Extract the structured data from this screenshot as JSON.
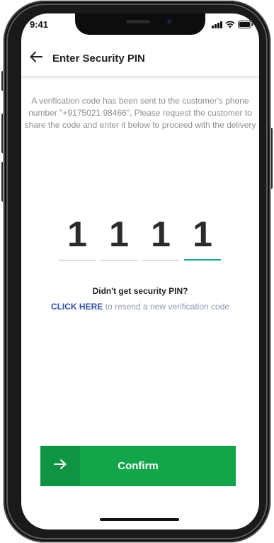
{
  "status_bar": {
    "time": "9:41"
  },
  "header": {
    "title": "Enter Security PIN",
    "back_icon": "arrow-left-icon"
  },
  "message": {
    "text": "A verification code has been sent to the customer's phone number \"+9175021 98466\", Please request the customer to share the code and enter it below to proceed with the delivery"
  },
  "pin": {
    "digits": [
      "1",
      "1",
      "1",
      "1"
    ],
    "active_index": 3
  },
  "resend": {
    "question": "Didn't get security PIN?",
    "link_label": "CLICK HERE",
    "suffix": " to resend a new verification code"
  },
  "confirm": {
    "label": "Confirm",
    "icon": "arrow-right-icon"
  },
  "colors": {
    "primary_green": "#12a54a",
    "dark_green": "#0f9443",
    "active_underline": "#1a9e8f",
    "link_blue": "#2d4fb3",
    "muted_text": "#8e8e8e"
  }
}
